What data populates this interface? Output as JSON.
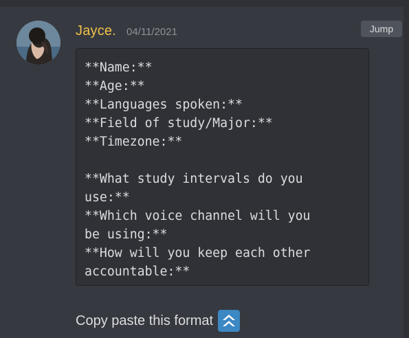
{
  "message": {
    "author": "Jayce.",
    "timestamp": "04/11/2021",
    "jump_label": "Jump",
    "code_lines": [
      "**Name:**",
      "**Age:**",
      "**Languages spoken:**",
      "**Field of study/Major:**",
      "**Timezone:**",
      "",
      "**What study intervals do you",
      "use:**",
      "**Which voice channel will you",
      "be using:**",
      "**How will you keep each other",
      "accountable:**"
    ],
    "text": "Copy paste this format",
    "emoji": "double-up-arrow-icon"
  },
  "colors": {
    "background": "#36393f",
    "code_background": "#2f3136",
    "author": "#f0c24b",
    "emoji_blue": "#3b88c3"
  }
}
